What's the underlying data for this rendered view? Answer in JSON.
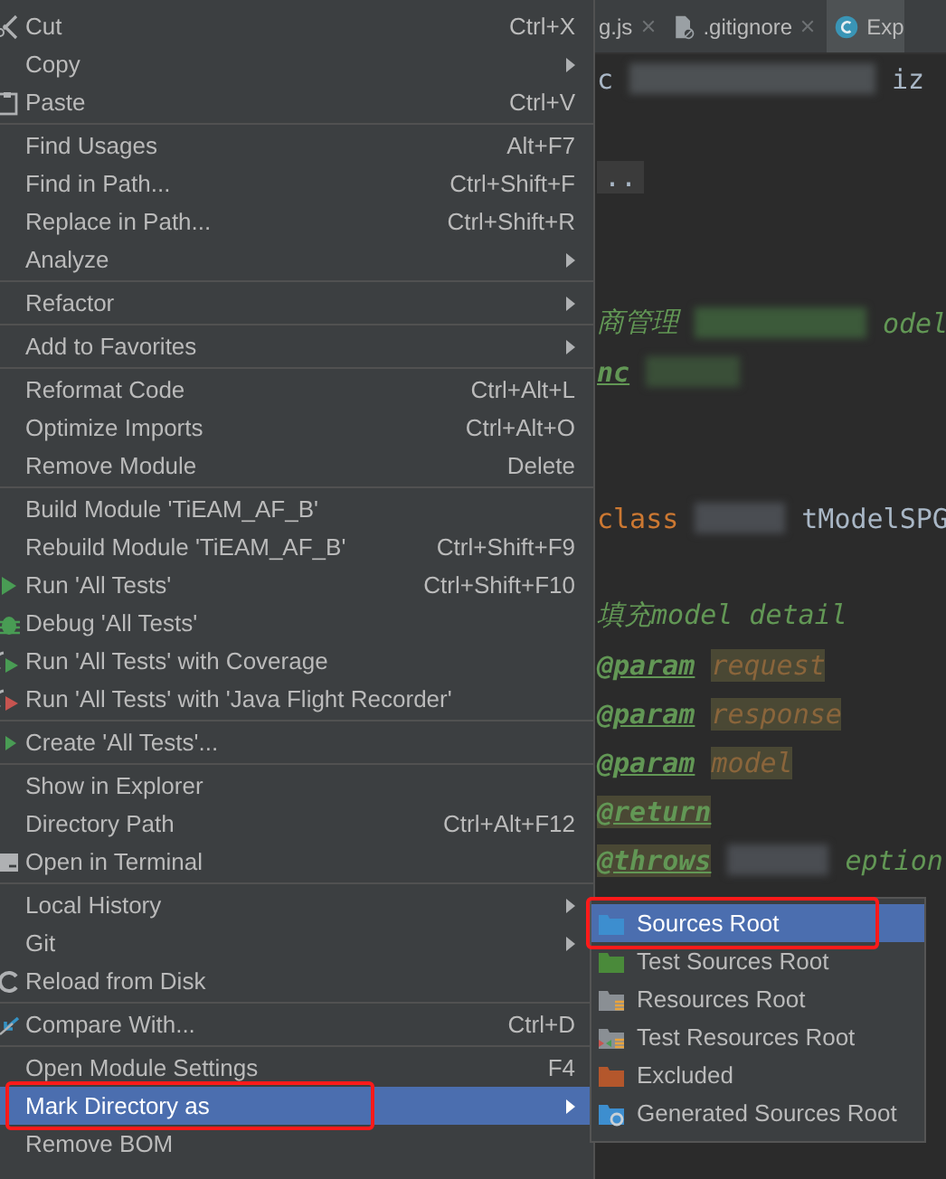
{
  "context_menu": {
    "groups": [
      {
        "items": [
          {
            "label": "Cut",
            "shortcut": "Ctrl+X",
            "has_submenu": false,
            "selected": false,
            "annotated": false
          },
          {
            "label": "Copy",
            "has_submenu": true,
            "selected": false,
            "annotated": false
          },
          {
            "label": "Paste",
            "shortcut": "Ctrl+V",
            "has_submenu": false,
            "selected": false,
            "annotated": false
          }
        ]
      },
      {
        "items": [
          {
            "label": "Find Usages",
            "shortcut": "Alt+F7",
            "has_submenu": false,
            "selected": false,
            "annotated": false
          },
          {
            "label": "Find in Path...",
            "shortcut": "Ctrl+Shift+F",
            "has_submenu": false,
            "selected": false,
            "annotated": false
          },
          {
            "label": "Replace in Path...",
            "shortcut": "Ctrl+Shift+R",
            "has_submenu": false,
            "selected": false,
            "annotated": false
          },
          {
            "label": "Analyze",
            "has_submenu": true,
            "selected": false,
            "annotated": false
          }
        ]
      },
      {
        "items": [
          {
            "label": "Refactor",
            "has_submenu": true,
            "selected": false,
            "annotated": false
          }
        ]
      },
      {
        "items": [
          {
            "label": "Add to Favorites",
            "has_submenu": true,
            "selected": false,
            "annotated": false
          }
        ]
      },
      {
        "items": [
          {
            "label": "Reformat Code",
            "shortcut": "Ctrl+Alt+L",
            "has_submenu": false,
            "selected": false,
            "annotated": false
          },
          {
            "label": "Optimize Imports",
            "shortcut": "Ctrl+Alt+O",
            "has_submenu": false,
            "selected": false,
            "annotated": false
          },
          {
            "label": "Remove Module",
            "shortcut": "Delete",
            "has_submenu": false,
            "selected": false,
            "annotated": false
          }
        ]
      },
      {
        "items": [
          {
            "label": "Build Module 'TiEAM_AF_B'",
            "has_submenu": false,
            "selected": false,
            "annotated": false
          },
          {
            "label": "Rebuild Module 'TiEAM_AF_B'",
            "shortcut": "Ctrl+Shift+F9",
            "has_submenu": false,
            "selected": false,
            "annotated": false
          },
          {
            "label": "Run 'All Tests'",
            "shortcut": "Ctrl+Shift+F10",
            "has_submenu": false,
            "selected": false,
            "annotated": false
          },
          {
            "label": "Debug 'All Tests'",
            "has_submenu": false,
            "selected": false,
            "annotated": false
          },
          {
            "label": "Run 'All Tests' with Coverage",
            "has_submenu": false,
            "selected": false,
            "annotated": false
          },
          {
            "label": "Run 'All Tests' with 'Java Flight Recorder'",
            "has_submenu": false,
            "selected": false,
            "annotated": false
          }
        ]
      },
      {
        "items": [
          {
            "label": "Create 'All Tests'...",
            "has_submenu": false,
            "selected": false,
            "annotated": false
          }
        ]
      },
      {
        "items": [
          {
            "label": "Show in Explorer",
            "has_submenu": false,
            "selected": false,
            "annotated": false
          },
          {
            "label": "Directory Path",
            "shortcut": "Ctrl+Alt+F12",
            "has_submenu": false,
            "selected": false,
            "annotated": false
          },
          {
            "label": "Open in Terminal",
            "has_submenu": false,
            "selected": false,
            "annotated": false
          }
        ]
      },
      {
        "items": [
          {
            "label": "Local History",
            "has_submenu": true,
            "selected": false,
            "annotated": false
          },
          {
            "label": "Git",
            "has_submenu": true,
            "selected": false,
            "annotated": false
          },
          {
            "label": "Reload from Disk",
            "has_submenu": false,
            "selected": false,
            "annotated": false
          }
        ]
      },
      {
        "items": [
          {
            "label": "Compare With...",
            "shortcut": "Ctrl+D",
            "has_submenu": false,
            "selected": false,
            "annotated": false
          }
        ]
      },
      {
        "items": [
          {
            "label": "Open Module Settings",
            "shortcut": "F4",
            "has_submenu": false,
            "selected": false,
            "annotated": false
          },
          {
            "label": "Mark Directory as",
            "has_submenu": true,
            "selected": true,
            "annotated": true
          },
          {
            "label": "Remove BOM",
            "has_submenu": false,
            "selected": false,
            "annotated": false
          }
        ]
      }
    ]
  },
  "submenu": {
    "items": [
      {
        "label": "Sources Root",
        "selected": true,
        "annotated": true
      },
      {
        "label": "Test Sources Root",
        "selected": false,
        "annotated": false
      },
      {
        "label": "Resources Root",
        "selected": false,
        "annotated": false
      },
      {
        "label": "Test Resources Root",
        "selected": false,
        "annotated": false
      },
      {
        "label": "Excluded",
        "selected": false,
        "annotated": false
      },
      {
        "label": "Generated Sources Root",
        "selected": false,
        "annotated": false
      }
    ]
  },
  "editor": {
    "tabs": [
      {
        "label": "g.js",
        "selected": false
      },
      {
        "label": ".gitignore",
        "selected": false
      },
      {
        "label": "Exp",
        "selected": true
      }
    ],
    "lines": [
      {
        "kind": "code",
        "segments": [
          {
            "kind": "plain",
            "text": "c"
          },
          {
            "kind": "blur"
          },
          {
            "kind": "plain",
            "text": "iz"
          }
        ]
      },
      {
        "kind": "blank"
      },
      {
        "kind": "code",
        "segments": [
          {
            "kind": "fold",
            "text": ".."
          }
        ]
      },
      {
        "kind": "blank"
      },
      {
        "kind": "blank"
      },
      {
        "kind": "code",
        "segments": [
          {
            "kind": "comment",
            "text": "商管理"
          },
          {
            "kind": "blur"
          },
          {
            "kind": "comment",
            "text": "odel"
          }
        ]
      },
      {
        "kind": "code",
        "segments": [
          {
            "kind": "doc_tag",
            "text": "nc",
            "highlighted": false
          },
          {
            "kind": "blur"
          }
        ]
      },
      {
        "kind": "blank"
      },
      {
        "kind": "blank"
      },
      {
        "kind": "code",
        "segments": [
          {
            "kind": "keyword",
            "text": "class"
          },
          {
            "kind": "blur"
          },
          {
            "kind": "plain",
            "text": "tModelSPG"
          }
        ]
      },
      {
        "kind": "blank"
      },
      {
        "kind": "code",
        "segments": [
          {
            "kind": "comment",
            "text": "填充model detail"
          }
        ]
      },
      {
        "kind": "code",
        "segments": [
          {
            "kind": "doc_tag",
            "text": "@param",
            "highlighted": false
          },
          {
            "kind": "doc_value",
            "text": "request",
            "highlighted": true
          }
        ]
      },
      {
        "kind": "code",
        "segments": [
          {
            "kind": "doc_tag",
            "text": "@param",
            "highlighted": false
          },
          {
            "kind": "doc_value",
            "text": "response",
            "highlighted": true
          }
        ]
      },
      {
        "kind": "code",
        "segments": [
          {
            "kind": "doc_tag",
            "text": "@param",
            "highlighted": false
          },
          {
            "kind": "doc_value",
            "text": "model",
            "highlighted": true
          }
        ]
      },
      {
        "kind": "code",
        "segments": [
          {
            "kind": "doc_tag",
            "text": "@return",
            "highlighted": true
          }
        ]
      },
      {
        "kind": "code",
        "segments": [
          {
            "kind": "doc_tag",
            "text": "@throws",
            "highlighted": true
          },
          {
            "kind": "blur"
          },
          {
            "kind": "comment",
            "text": "eption"
          }
        ]
      }
    ]
  }
}
